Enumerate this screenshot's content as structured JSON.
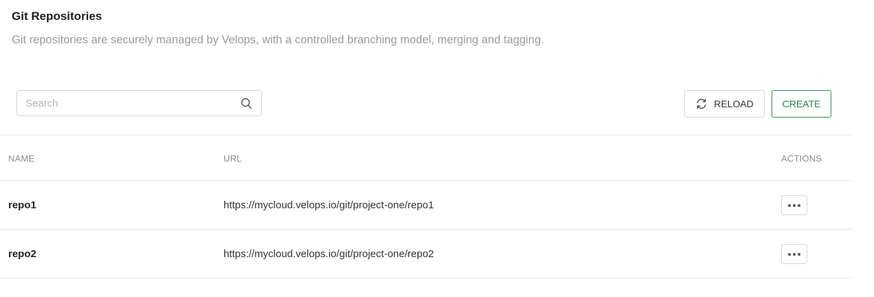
{
  "header": {
    "title": "Git Repositories",
    "description": "Git repositories are securely managed by Velops, with a controlled branching model, merging and tagging."
  },
  "toolbar": {
    "search_placeholder": "Search",
    "search_value": "",
    "reload_label": "RELOAD",
    "create_label": "CREATE"
  },
  "table": {
    "columns": {
      "name": "NAME",
      "url": "URL",
      "actions": "ACTIONS"
    },
    "rows": [
      {
        "name": "repo1",
        "url": "https://mycloud.velops.io/git/project-one/repo1"
      },
      {
        "name": "repo2",
        "url": "https://mycloud.velops.io/git/project-one/repo2"
      }
    ]
  },
  "icons": {
    "search": "search-icon",
    "reload": "refresh-icon",
    "row_actions": "more-horizontal-icon"
  },
  "colors": {
    "accent_green": "#2e8b57",
    "muted_text": "#9a9a9a",
    "border": "#d6d6d6"
  }
}
